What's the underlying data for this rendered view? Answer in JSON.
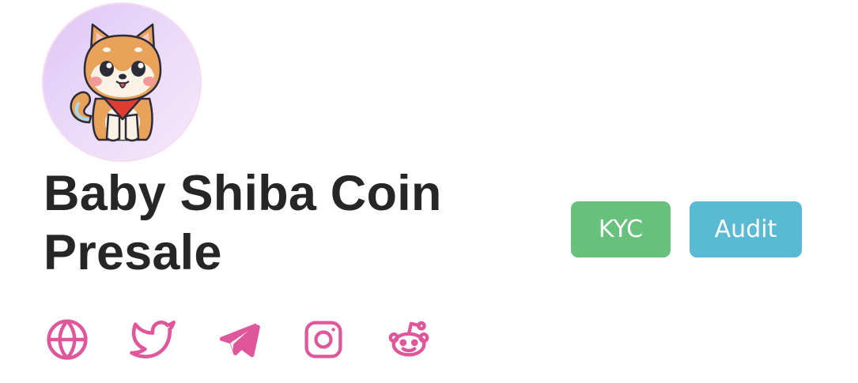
{
  "project": {
    "logo_icon": "shiba-dog-avatar",
    "title": "Baby Shiba Coin Presale"
  },
  "badges": [
    {
      "label": "KYC",
      "color": "#68c07d"
    },
    {
      "label": "Audit",
      "color": "#5ab9d3"
    }
  ],
  "socials": {
    "accent_color": "#e0569a",
    "items": [
      {
        "icon": "globe-icon"
      },
      {
        "icon": "twitter-icon"
      },
      {
        "icon": "telegram-icon"
      },
      {
        "icon": "instagram-icon"
      },
      {
        "icon": "reddit-icon"
      }
    ]
  }
}
